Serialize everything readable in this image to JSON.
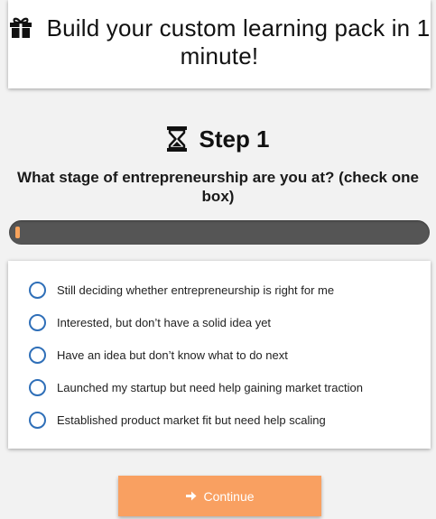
{
  "header": {
    "title": "Build your custom learning pack in 1 minute!",
    "icon": "gift-icon"
  },
  "step": {
    "label": "Step 1",
    "icon": "hourglass-icon"
  },
  "question": "What stage of entrepreneurship are you at? (check one box)",
  "progress": {
    "percent": 1,
    "fill_color": "#f7a35c",
    "track_color": "#555555"
  },
  "options": [
    {
      "label": "Still deciding whether entrepreneurship is right for me",
      "selected": false
    },
    {
      "label": "Interested, but don’t have a solid idea yet",
      "selected": false
    },
    {
      "label": "Have an idea but don’t know what to do next",
      "selected": false
    },
    {
      "label": "Launched my startup but need help gaining market traction",
      "selected": false
    },
    {
      "label": "Established product market fit but need help scaling",
      "selected": false
    }
  ],
  "continue_button": {
    "label": "Continue",
    "icon": "arrow-right-icon",
    "color": "#f9a061"
  }
}
